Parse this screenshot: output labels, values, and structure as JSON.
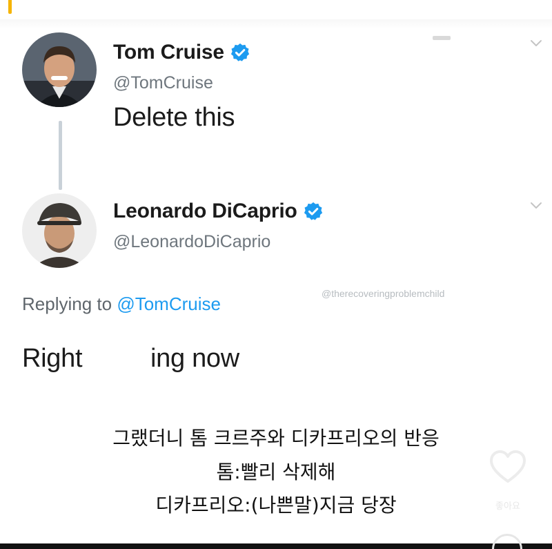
{
  "tweets": [
    {
      "name": "Tom Cruise",
      "handle": "@TomCruise",
      "text": "Delete this",
      "verified": true
    },
    {
      "name": "Leonardo DiCaprio",
      "handle": "@LeonardoDiCaprio",
      "replying_prefix": "Replying to",
      "replying_to": "@TomCruise",
      "text_start": "Right",
      "text_end": "ing now",
      "verified": true
    }
  ],
  "watermark": "@therecoveringproblemchild",
  "caption": {
    "line1": "그랬더니 톰 크르주와 디카프리오의 반응",
    "line2": "톰:빨리 삭제해",
    "line3": "디카프리오:(나쁜말)지금 당장"
  },
  "like": {
    "label": "좋아요"
  },
  "colors": {
    "verified": "#1d9bf0",
    "link": "#1d9bf0",
    "accent": "#f6b400",
    "thread_line": "#c9d1d8"
  },
  "icons": [
    "verified-badge-icon",
    "chevron-down-icon",
    "heart-icon"
  ]
}
